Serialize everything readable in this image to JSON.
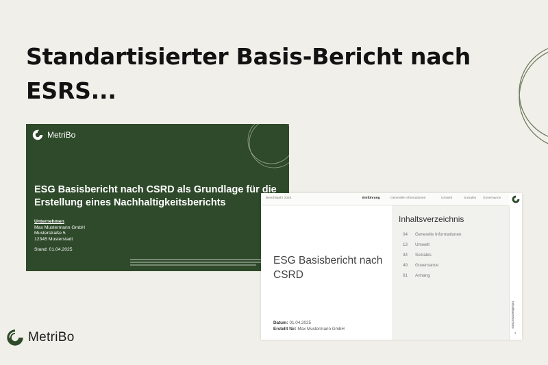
{
  "headline": "Standartisierter Basis-Bericht nach ESRS...",
  "brand": {
    "name": "MetriBo",
    "color": "#2e4a2a"
  },
  "cover": {
    "logo_text": "MetriBo",
    "heading": "ESG Basisbericht nach CSRD als Grundlage für die Erstellung eines Nachhaltigkeitsberichts",
    "company_label": "Unternehmen",
    "company_name": "Max Mustermann GmbH",
    "street": "Musterstraße 5",
    "city": "12345 Musterstadt",
    "date": "Stand: 01.04.2025",
    "background": "#2e4a2a"
  },
  "toc": {
    "header": {
      "left": "Berichtsjahr 2024",
      "tabs": [
        "Einführung",
        "Generelle Informationen",
        "Umwelt",
        "Soziales",
        "Governance"
      ],
      "active_tab": "Einführung"
    },
    "title": "ESG Basisbericht nach CSRD",
    "date_label": "Datum:",
    "date_value": "01.04.2025",
    "created_label": "Erstellt für:",
    "created_value": "Max Mustermann GmbH",
    "contents_title": "Inhaltsverzeichnis",
    "items": [
      {
        "num": "04",
        "label": "Generelle Informationen"
      },
      {
        "num": "13",
        "label": "Umwelt"
      },
      {
        "num": "34",
        "label": "Soziales"
      },
      {
        "num": "49",
        "label": "Governance"
      },
      {
        "num": "61",
        "label": "Anhang"
      }
    ],
    "sidebar_label": "Inhaltsverzeichnis",
    "page_number": "3"
  },
  "footer_brand": "MetriBo"
}
